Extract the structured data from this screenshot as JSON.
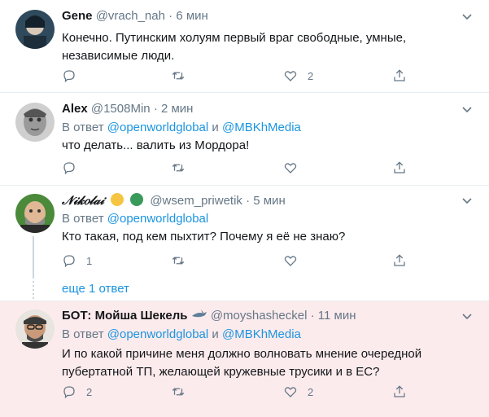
{
  "tweets": [
    {
      "name": "Gene",
      "handle": "@vrach_nah",
      "dot": "·",
      "time": "6 мин",
      "text": "Конечно. Путинским холуям первый враг свободные, умные, независимые люди.",
      "reply_count": "",
      "retweet_count": "",
      "like_count": "2"
    },
    {
      "name": "Alex",
      "handle": "@1508Min",
      "dot": "·",
      "time": "2 мин",
      "reply_prefix": "В ответ",
      "mention1": "@openworldglobal",
      "conj": "и",
      "mention2": "@MBKhMedia",
      "text": "что делать... валить из Мордора!",
      "reply_count": "",
      "retweet_count": "",
      "like_count": ""
    },
    {
      "name": "𝒩𝒾𝓀𝑜𝓁𝒶𝒾",
      "handle": "@wsem_priwetik",
      "dot": "·",
      "time": "5 мин",
      "reply_prefix": "В ответ",
      "mention1": "@openworldglobal",
      "text": "Кто такая, под кем пыхтит? Почему я её не знаю?",
      "reply_count": "1",
      "retweet_count": "",
      "like_count": ""
    },
    {
      "name": "БОТ: Мойша Шекель",
      "handle": "@moyshasheckel",
      "dot": "·",
      "time": "11 мин",
      "reply_prefix": "В ответ",
      "mention1": "@openworldglobal",
      "conj": "и",
      "mention2": "@MBKhMedia",
      "text": "И по какой причине меня должно волновать мнение очередной пубертатной ТП, желающей кружевные трусики и в ЕС?",
      "reply_count": "2",
      "retweet_count": "",
      "like_count": "2"
    }
  ],
  "more_replies": "еще 1 ответ",
  "colors": {
    "link": "#1b95e0",
    "muted": "#657786",
    "highlight_bg": "#fcebed",
    "border": "#e6ecf0"
  },
  "icons": [
    "reply-icon",
    "retweet-icon",
    "like-icon",
    "share-icon",
    "chevron-down-icon"
  ]
}
